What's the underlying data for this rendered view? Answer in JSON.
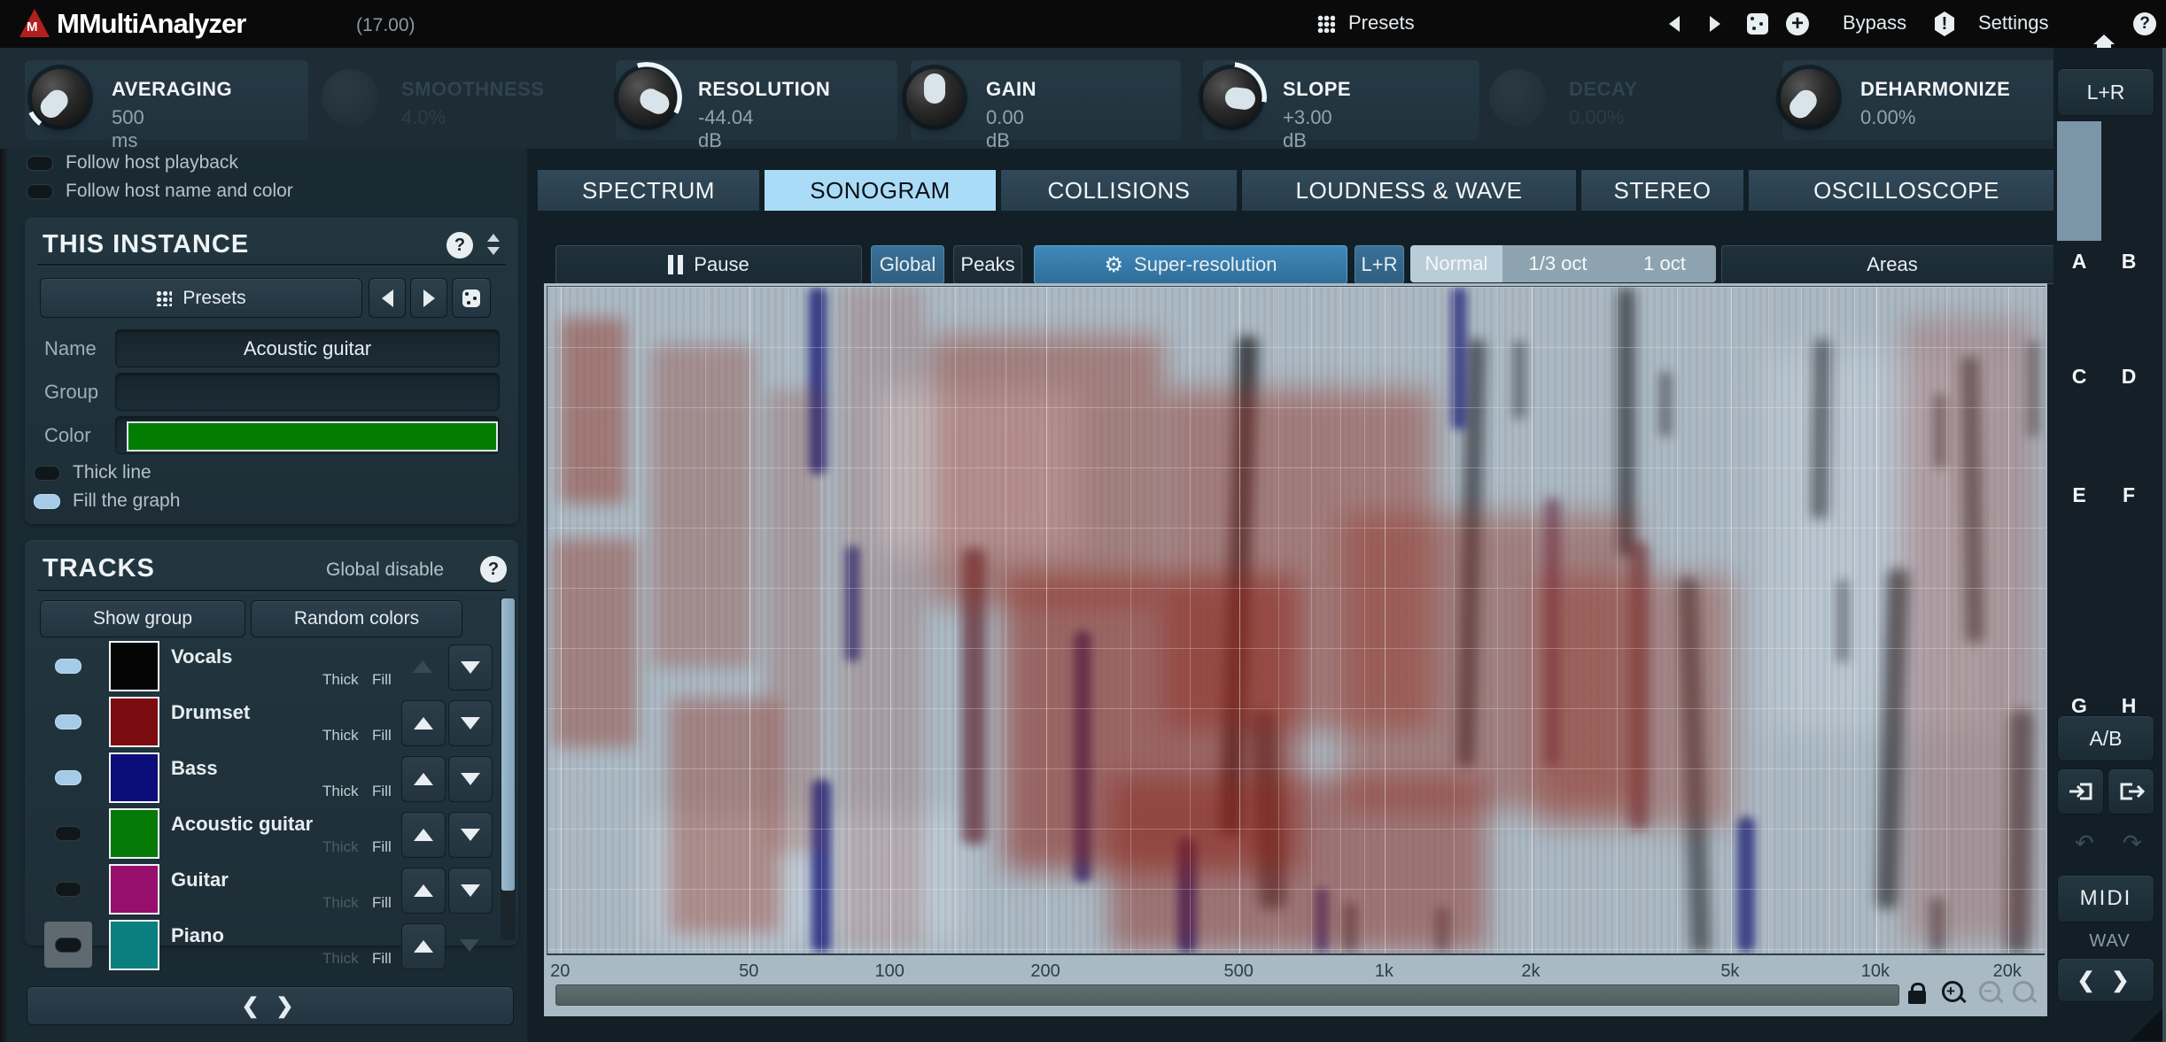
{
  "titlebar": {
    "app_name": "MMultiAnalyzer",
    "version": "(17.00)",
    "presets_label": "Presets",
    "bypass_label": "Bypass",
    "settings_label": "Settings",
    "icons": [
      "menu-grid-icon",
      "prev-arrow-icon",
      "next-arrow-icon",
      "dice-icon",
      "plus-icon",
      "alert-icon",
      "home-icon",
      "help-icon"
    ]
  },
  "knobs": [
    {
      "label": "AVERAGING",
      "value": "500 ms",
      "disabled": false
    },
    {
      "label": "SMOOTHNESS",
      "value": "4.0%",
      "disabled": true
    },
    {
      "label": "RESOLUTION",
      "value": "-44.04 dB",
      "disabled": false
    },
    {
      "label": "GAIN",
      "value": "0.00 dB",
      "disabled": false
    },
    {
      "label": "SLOPE",
      "value": "+3.00 dB",
      "disabled": false
    },
    {
      "label": "DECAY",
      "value": "0.00%",
      "disabled": true
    },
    {
      "label": "DEHARMONIZE",
      "value": "0.00%",
      "disabled": false
    }
  ],
  "left_panel": {
    "follow_host_playback": "Follow host playback",
    "follow_host_name": "Follow host name and color",
    "this_instance": {
      "title": "THIS INSTANCE",
      "help_glyph": "?",
      "presets_label": "Presets",
      "name_label": "Name",
      "name_value": "Acoustic guitar",
      "group_label": "Group",
      "group_value": "",
      "color_label": "Color",
      "color_value": "#027d02",
      "thick_line_label": "Thick line",
      "fill_graph_label": "Fill the graph"
    },
    "tracks": {
      "title": "TRACKS",
      "global_disable_label": "Global disable",
      "help_glyph": "?",
      "show_group_label": "Show group",
      "random_colors_label": "Random colors",
      "thick_label": "Thick",
      "fill_label": "Fill",
      "rows": [
        {
          "name": "Vocals",
          "color": "#050505",
          "enabled": true,
          "thick_dim": false,
          "up_enabled": false,
          "down_enabled": true
        },
        {
          "name": "Drumset",
          "color": "#7c0b10",
          "enabled": true,
          "thick_dim": false,
          "up_enabled": true,
          "down_enabled": true
        },
        {
          "name": "Bass",
          "color": "#0d0d7a",
          "enabled": true,
          "thick_dim": false,
          "up_enabled": true,
          "down_enabled": true
        },
        {
          "name": "Acoustic guitar",
          "color": "#077907",
          "enabled": false,
          "thick_dim": true,
          "up_enabled": true,
          "down_enabled": true
        },
        {
          "name": "Guitar",
          "color": "#970f6d",
          "enabled": false,
          "thick_dim": true,
          "up_enabled": true,
          "down_enabled": true
        },
        {
          "name": "Piano",
          "color": "#0b7f7f",
          "enabled": false,
          "thick_dim": true,
          "up_enabled": true,
          "down_enabled": false
        }
      ]
    },
    "expander_chevrons": "❮ ❯"
  },
  "tabs": [
    {
      "label": "SPECTRUM",
      "selected": false
    },
    {
      "label": "SONOGRAM",
      "selected": true
    },
    {
      "label": "COLLISIONS",
      "selected": false
    },
    {
      "label": "LOUDNESS & WAVE",
      "selected": false
    },
    {
      "label": "STEREO",
      "selected": false
    },
    {
      "label": "OSCILLOSCOPE",
      "selected": false
    }
  ],
  "toolbar": {
    "pause_label": "Pause",
    "global_label": "Global",
    "peaks_label": "Peaks",
    "super_resolution_label": "Super-resolution",
    "lr_label": "L+R",
    "modes": [
      "Normal",
      "1/3 oct",
      "1 oct"
    ],
    "selected_mode": "Normal",
    "areas_label": "Areas"
  },
  "sonogram": {
    "freq_labels": [
      "20",
      "50",
      "100",
      "200",
      "500",
      "1k",
      "2k",
      "5k",
      "10k",
      "20k"
    ],
    "icons": [
      "lock-icon",
      "zoom-in-icon",
      "zoom-out-icon",
      "zoom-reset-icon"
    ]
  },
  "right_sidebar": {
    "lr_label": "L+R",
    "slots": [
      "A",
      "B",
      "C",
      "D",
      "E",
      "F",
      "G",
      "H"
    ],
    "selected_slot": "A",
    "ab_label": "A/B",
    "midi_label": "MIDI",
    "wav_label": "WAV",
    "expander_chevrons": "❮ ❯",
    "icons": [
      "copy-in-icon",
      "copy-out-icon",
      "undo-icon",
      "redo-icon",
      "resize-handle"
    ]
  },
  "colors": {
    "accent_blue": "#4089ba",
    "selected_tab": "#aadcf8",
    "plot_background": "#a9bac5",
    "toggle_on": "#a5cbe8"
  }
}
